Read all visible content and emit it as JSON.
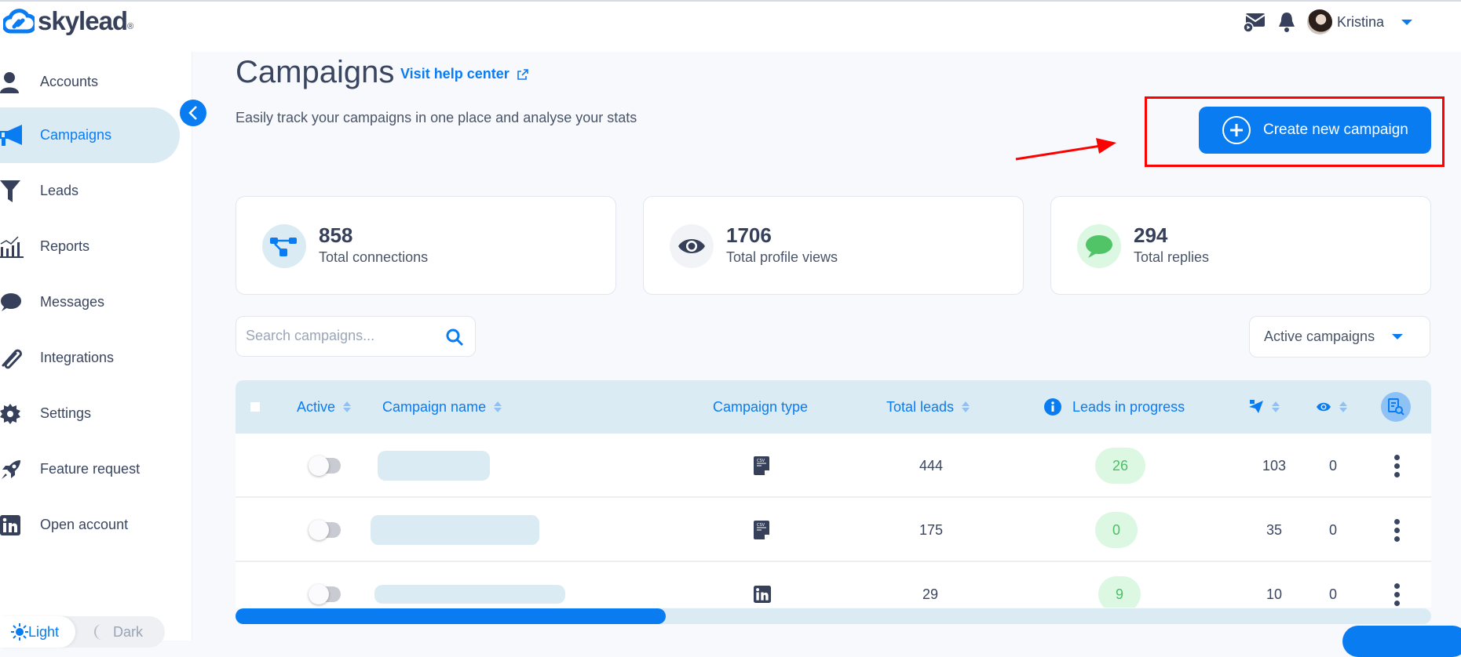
{
  "app": {
    "brand": "skylead",
    "brand_mark": "®"
  },
  "header": {
    "username": "Kristina",
    "icons": [
      "mail-send-icon",
      "bell-icon"
    ]
  },
  "sidebar": {
    "items": [
      {
        "label": "Accounts",
        "icon": "user-icon",
        "active": false
      },
      {
        "label": "Campaigns",
        "icon": "megaphone-icon",
        "active": true
      },
      {
        "label": "Leads",
        "icon": "funnel-icon",
        "active": false
      },
      {
        "label": "Reports",
        "icon": "chart-icon",
        "active": false
      },
      {
        "label": "Messages",
        "icon": "chat-bubble-icon",
        "active": false
      },
      {
        "label": "Integrations",
        "icon": "paperclip-icon",
        "active": false
      },
      {
        "label": "Settings",
        "icon": "gear-icon",
        "active": false
      },
      {
        "label": "Feature request",
        "icon": "rocket-icon",
        "active": false
      },
      {
        "label": "Open account",
        "icon": "linkedin-icon",
        "active": false
      }
    ],
    "theme": {
      "light_label": "Light",
      "dark_label": "Dark",
      "selected": "Light"
    }
  },
  "page": {
    "title": "Campaigns",
    "help_link": "Visit help center",
    "subtitle": "Easily track your campaigns in one place and analyse your stats",
    "create_button": "Create new campaign"
  },
  "stats": [
    {
      "value": "858",
      "label": "Total connections",
      "icon": "connections-icon"
    },
    {
      "value": "1706",
      "label": "Total profile views",
      "icon": "eye-icon"
    },
    {
      "value": "294",
      "label": "Total replies",
      "icon": "reply-bubble-icon"
    }
  ],
  "search": {
    "placeholder": "Search campaigns...",
    "value": ""
  },
  "filter": {
    "selected": "Active campaigns"
  },
  "table": {
    "columns": {
      "active": "Active",
      "name": "Campaign name",
      "type": "Campaign type",
      "total_leads": "Total leads",
      "in_progress": "Leads in progress",
      "sent_icon": "send-icon",
      "views_icon": "eye-icon",
      "column_picker_icon": "column-search-icon"
    },
    "rows": [
      {
        "active": false,
        "name": "",
        "type": "CSV",
        "total_leads": "444",
        "in_progress": "26",
        "sent": "103",
        "views": "0"
      },
      {
        "active": false,
        "name": "",
        "type": "CSV",
        "total_leads": "175",
        "in_progress": "0",
        "sent": "35",
        "views": "0"
      },
      {
        "active": false,
        "name": "",
        "type": "LinkedIn",
        "total_leads": "29",
        "in_progress": "9",
        "sent": "10",
        "views": "0"
      }
    ]
  },
  "horizontal_scroll": {
    "position_fraction": 0.36
  },
  "colors": {
    "accent": "#0a7cf2",
    "success": "#4cbd68",
    "annotation": "#ff0000"
  }
}
